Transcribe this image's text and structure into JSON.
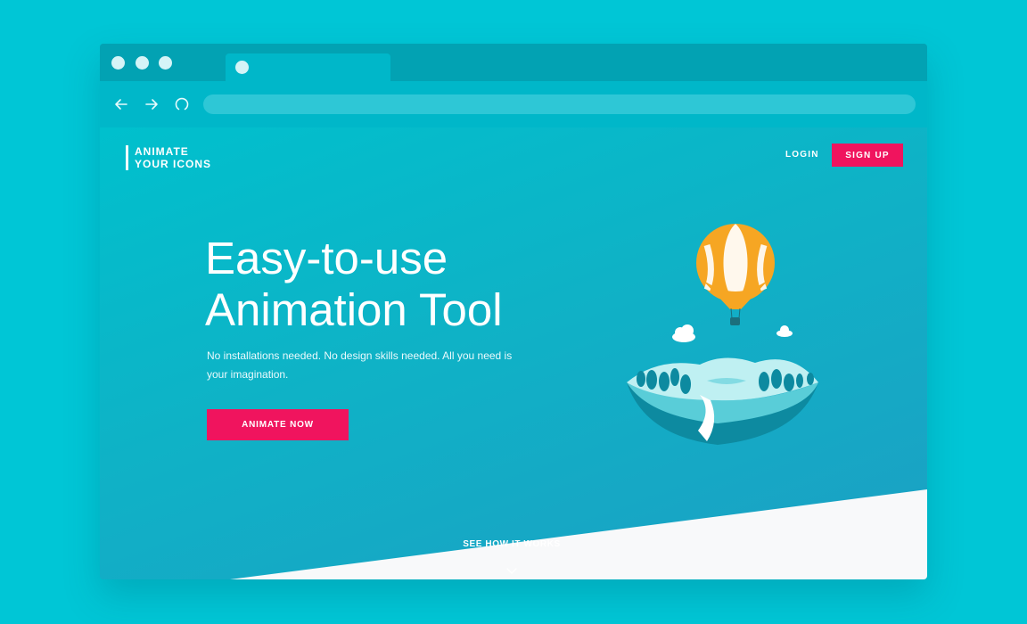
{
  "browser": {
    "url": "",
    "tab_title": ""
  },
  "header": {
    "logo_line1": "ANIMATE",
    "logo_line2": "YOUR ICONS",
    "login_label": "LOGIN",
    "signup_label": "SIGN UP"
  },
  "hero": {
    "title_line1": "Easy-to-use",
    "title_line2": "Animation Tool",
    "subtitle": "No installations needed. No design skills needed. All you need is your imagination.",
    "cta_label": "ANIMATE NOW",
    "see_how_label": "SEE HOW IT WORKS"
  },
  "icons": {
    "back": "arrow-left-icon",
    "forward": "arrow-right-icon",
    "reload": "reload-icon",
    "scroll": "chevron-down-icon"
  },
  "colors": {
    "background": "#00c6d6",
    "accent": "#f0145e",
    "titlebar": "#02a2b3",
    "navbar": "#00b7c9",
    "balloon": "#f6b133"
  }
}
